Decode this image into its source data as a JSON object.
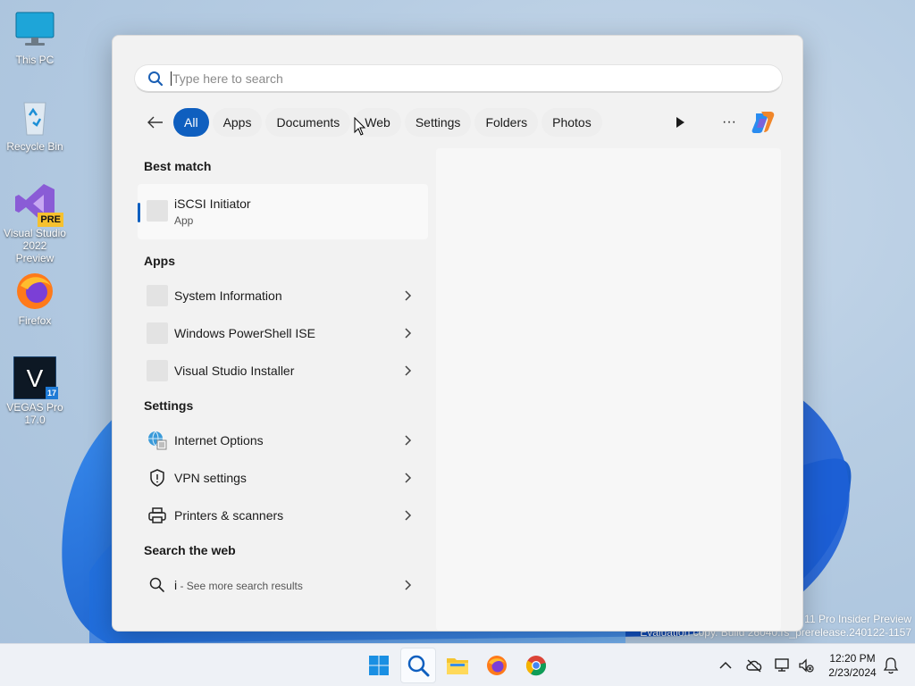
{
  "desktop": {
    "icons": [
      {
        "label": "This PC"
      },
      {
        "label": "Recycle Bin"
      },
      {
        "label": "Visual Studio 2022 Preview",
        "badge": "PRE"
      },
      {
        "label": "Firefox"
      },
      {
        "label": "VEGAS Pro 17.0",
        "badge": "17"
      }
    ],
    "watermark_line1": "11 Pro Insider Preview",
    "watermark_line2": "Evaluation copy. Build 26040.rs_prerelease.240122-1157"
  },
  "search": {
    "placeholder": "Type here to search",
    "filters": [
      {
        "label": "All",
        "active": true
      },
      {
        "label": "Apps"
      },
      {
        "label": "Documents"
      },
      {
        "label": "Web"
      },
      {
        "label": "Settings"
      },
      {
        "label": "Folders"
      },
      {
        "label": "Photos"
      }
    ],
    "more_label": "···"
  },
  "results": {
    "best_match_title": "Best match",
    "best_match": {
      "name": "iSCSI Initiator",
      "type": "App"
    },
    "apps_title": "Apps",
    "apps": [
      {
        "label": "System Information"
      },
      {
        "label": "Windows PowerShell ISE"
      },
      {
        "label": "Visual Studio Installer"
      }
    ],
    "settings_title": "Settings",
    "settings": [
      {
        "label": "Internet Options",
        "icon": "internet-options-icon"
      },
      {
        "label": "VPN settings",
        "icon": "shield-icon"
      },
      {
        "label": "Printers & scanners",
        "icon": "printer-icon"
      }
    ],
    "web_title": "Search the web",
    "web": {
      "query": "i",
      "hint": " - See more search results"
    }
  },
  "taskbar": {
    "time": "12:20 PM",
    "date": "2/23/2024"
  },
  "colors": {
    "accent": "#0f5fbf",
    "panel_bg": "#f2f2f2"
  }
}
